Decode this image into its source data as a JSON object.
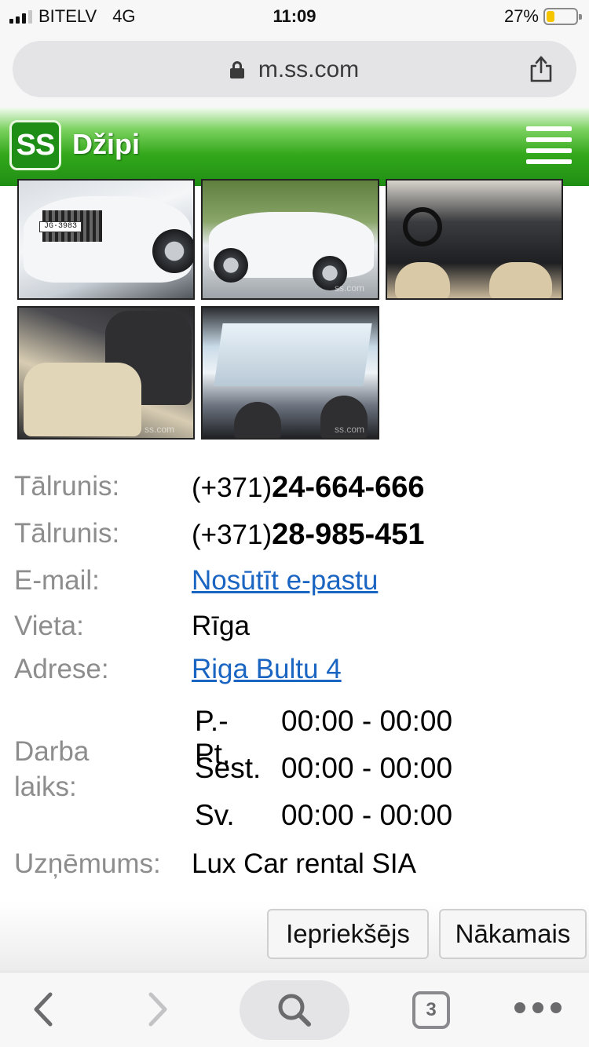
{
  "status_bar": {
    "carrier": "BITELV",
    "network": "4G",
    "time": "11:09",
    "battery_percent": "27%",
    "battery_level": 0.27,
    "battery_color": "#f5c500"
  },
  "browser": {
    "url": "m.ss.com",
    "lock_icon": "lock-icon",
    "share_icon": "share-icon"
  },
  "header": {
    "logo_text": "SS",
    "title": "Džipi",
    "menu_icon": "hamburger-menu-icon",
    "brand_color": "#2ea31b"
  },
  "details": {
    "phone_label_1": "Tālrunis:",
    "phone_prefix_1": "(+371)",
    "phone_number_1": "24-664-666",
    "phone_label_2": "Tālrunis:",
    "phone_prefix_2": "(+371)",
    "phone_number_2": "28-985-451",
    "email_label": "E-mail:",
    "email_link": "Nosūtīt e-pastu",
    "place_label": "Vieta:",
    "place_value": "Rīga",
    "address_label": "Adrese:",
    "address_link": "Riga Bultu 4",
    "hours_label_line1": "Darba",
    "hours_label_line2": "laiks:",
    "hours": [
      {
        "day": "P.-Pt.",
        "time": "00:00 - 00:00"
      },
      {
        "day": "Sest.",
        "time": "00:00 - 00:00"
      },
      {
        "day": "Sv.",
        "time": "00:00 - 00:00"
      }
    ],
    "company_label": "Uzņēmums:",
    "company_value": "Lux Car rental SIA",
    "link_color": "#1a64c2"
  },
  "pager": {
    "prev_label": "Iepriekšējs",
    "next_label": "Nākamais"
  },
  "toolbar": {
    "tab_count": "3",
    "back_icon": "back-chevron-icon",
    "forward_icon": "forward-chevron-icon",
    "search_icon": "search-icon",
    "tabs_icon": "tabs-icon",
    "more_icon": "more-dots-icon"
  }
}
